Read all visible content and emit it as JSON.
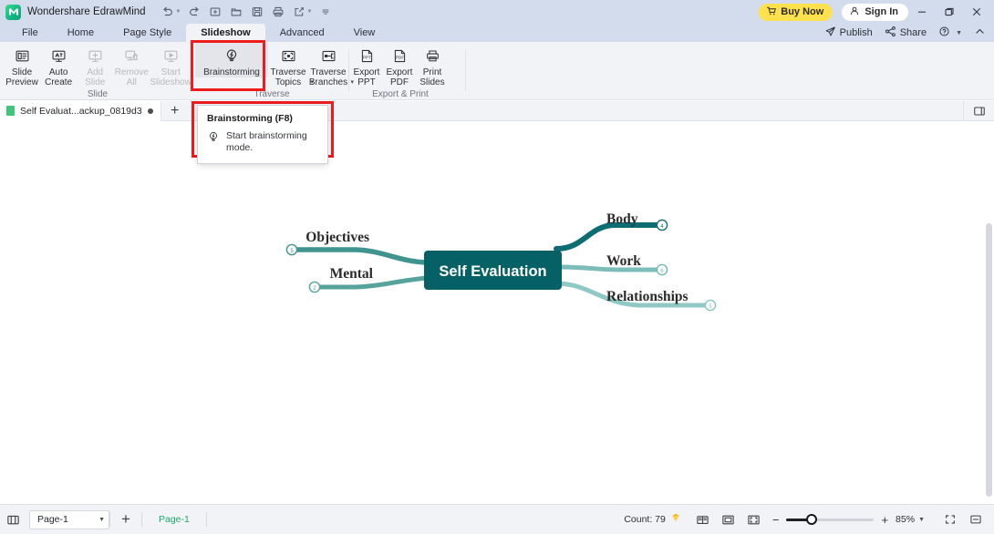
{
  "titlebar": {
    "app_name": "Wondershare EdrawMind",
    "logo_icon": "edrawmind-logo-icon",
    "quick_access": [
      {
        "icon": "undo-icon",
        "name": "undo",
        "has_caret": true
      },
      {
        "icon": "redo-icon",
        "name": "redo",
        "has_caret": false
      },
      {
        "icon": "new-icon",
        "name": "new",
        "has_caret": false
      },
      {
        "icon": "open-folder-icon",
        "name": "open",
        "has_caret": false
      },
      {
        "icon": "save-icon",
        "name": "save",
        "has_caret": false
      },
      {
        "icon": "print-icon",
        "name": "print",
        "has_caret": false
      },
      {
        "icon": "export-share-icon",
        "name": "export",
        "has_caret": true
      },
      {
        "icon": "overflow-icon",
        "name": "customize-quick-access",
        "has_caret": false
      }
    ],
    "buy_now_label": "Buy Now",
    "buy_now_icon": "cart-icon",
    "buy_now_color": "#ffe14d",
    "sign_in_label": "Sign In",
    "sign_in_icon": "user-icon",
    "window_buttons": [
      "minimize-icon",
      "restore-icon",
      "close-icon"
    ]
  },
  "menubar": {
    "tabs": [
      {
        "label": "File",
        "active": false
      },
      {
        "label": "Home",
        "active": false
      },
      {
        "label": "Page Style",
        "active": false
      },
      {
        "label": "Slideshow",
        "active": true
      },
      {
        "label": "Advanced",
        "active": false
      },
      {
        "label": "View",
        "active": false
      }
    ],
    "right_items": [
      {
        "label": "Publish",
        "icon": "publish-icon"
      },
      {
        "label": "Share",
        "icon": "share-icon"
      },
      {
        "label": "",
        "icon": "help-icon"
      },
      {
        "label": "",
        "icon": "chevron-up-icon"
      }
    ]
  },
  "ribbon": {
    "groups": [
      {
        "name": "slide",
        "label": "Slide",
        "items": [
          {
            "label": "Slide\nPreview",
            "icon": "slide-preview-icon",
            "disabled": false,
            "caret": false
          },
          {
            "label": "Auto\nCreate",
            "icon": "auto-create-icon",
            "disabled": false,
            "caret": false
          },
          {
            "label": "Add\nSlide",
            "icon": "add-slide-icon",
            "disabled": true,
            "caret": false
          },
          {
            "label": "Remove\nAll",
            "icon": "remove-all-icon",
            "disabled": true,
            "caret": false
          },
          {
            "label": "Start\nSlideshow",
            "icon": "start-slideshow-icon",
            "disabled": true,
            "caret": false
          }
        ]
      },
      {
        "name": "traverse",
        "label": "Traverse",
        "items": [
          {
            "label": "Brainstorming",
            "icon": "brainstorming-bulb-icon",
            "disabled": false,
            "caret": false,
            "highlighted": true
          },
          {
            "label": "Traverse\nTopics",
            "icon": "traverse-topics-icon",
            "disabled": false,
            "caret": true
          },
          {
            "label": "Traverse\nBranches",
            "icon": "traverse-branches-icon",
            "disabled": false,
            "caret": true
          }
        ]
      },
      {
        "name": "export-print",
        "label": "Export & Print",
        "items": [
          {
            "label": "Export\nPPT",
            "icon": "export-ppt-icon",
            "disabled": false,
            "caret": false
          },
          {
            "label": "Export\nPDF",
            "icon": "export-pdf-icon",
            "disabled": false,
            "caret": false
          },
          {
            "label": "Print\nSlides",
            "icon": "print-slides-icon",
            "disabled": false,
            "caret": false
          }
        ]
      }
    ]
  },
  "tooltip": {
    "title": "Brainstorming (F8)",
    "description": "Start brainstorming mode.",
    "icon": "brainstorming-bulb-icon"
  },
  "annotations": {
    "highlight_color": "#ee1c1c"
  },
  "tabbar": {
    "document_tab": "Self Evaluat...ackup_0819d3",
    "add_tab_label": "+",
    "panel_toggle_icon": "right-panel-toggle-icon"
  },
  "mindmap": {
    "root": "Self Evaluation",
    "root_fill": "#056165",
    "branches": [
      {
        "label": "Objectives",
        "side": "left",
        "count": "5",
        "color": "#3f9490"
      },
      {
        "label": "Mental",
        "side": "left",
        "count": "2",
        "color": "#56a39d"
      },
      {
        "label": "Body",
        "side": "right",
        "count": "4",
        "color": "#0d6d73"
      },
      {
        "label": "Work",
        "side": "right",
        "count": "6",
        "color": "#7cbdba"
      },
      {
        "label": "Relationships",
        "side": "right",
        "count": "5",
        "color": "#8ec9c5"
      }
    ]
  },
  "statusbar": {
    "outline_icon": "outline-view-icon",
    "page_selected": "Page-1",
    "page_dropdown_icon": "chevron-down-icon",
    "add_page_label": "+",
    "current_page": "Page-1",
    "count_label": "Count: 79",
    "count_icon": "gem-icon",
    "view_icons": [
      "two-page-view-icon",
      "fit-page-icon",
      "fit-width-icon"
    ],
    "zoom_minus": "−",
    "zoom_plus": "+",
    "zoom_level": "85%",
    "zoom_caret_icon": "chevron-down-icon",
    "fullscreen_icon": "fullscreen-icon",
    "presentation_icon": "presentation-icon"
  }
}
